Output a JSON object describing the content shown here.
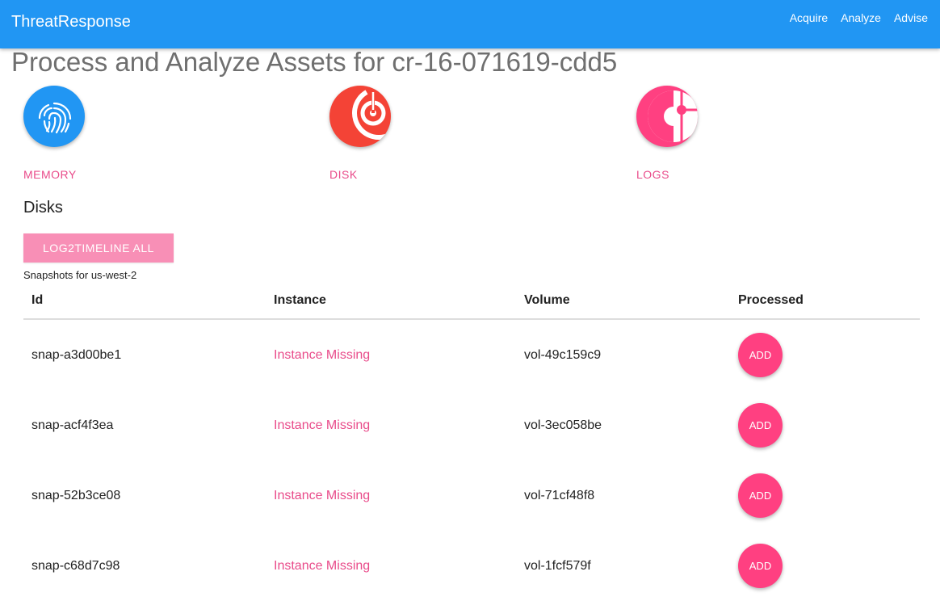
{
  "navbar": {
    "brand": "ThreatResponse",
    "links": [
      "Acquire",
      "Analyze",
      "Advise"
    ]
  },
  "page_title": "Process and Analyze Assets for cr-16-071619-cdd5",
  "assets": [
    {
      "label": "MEMORY",
      "icon": "fingerprint-icon",
      "color": "#2196f3"
    },
    {
      "label": "DISK",
      "icon": "disk-icon",
      "color": "#f44336"
    },
    {
      "label": "LOGS",
      "icon": "logs-icon",
      "color": "#ff4081"
    }
  ],
  "disks": {
    "title": "Disks",
    "log2timeline_label": "LOG2TIMELINE ALL",
    "snapshots_caption": "Snapshots for us-west-2",
    "columns": [
      "Id",
      "Instance",
      "Volume",
      "Processed"
    ],
    "rows": [
      {
        "id": "snap-a3d00be1",
        "instance": "Instance Missing",
        "volume": "vol-49c159c9",
        "action": "ADD"
      },
      {
        "id": "snap-acf4f3ea",
        "instance": "Instance Missing",
        "volume": "vol-3ec058be",
        "action": "ADD"
      },
      {
        "id": "snap-52b3ce08",
        "instance": "Instance Missing",
        "volume": "vol-71cf48f8",
        "action": "ADD"
      },
      {
        "id": "snap-c68d7c98",
        "instance": "Instance Missing",
        "volume": "vol-1fcf579f",
        "action": "ADD"
      }
    ]
  },
  "colors": {
    "primary": "#2196f3",
    "accent": "#ff4081",
    "link": "#e94b8a"
  }
}
